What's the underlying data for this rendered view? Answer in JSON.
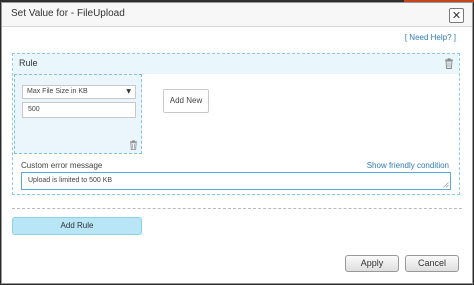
{
  "dialog": {
    "title": "Set Value for - FileUpload",
    "close_glyph": "✕",
    "help_link": "[ Need Help? ]"
  },
  "rule": {
    "title": "Rule",
    "condition": {
      "selected_option": "Max File Size in KB",
      "value": "500"
    },
    "add_new_label": "Add New",
    "custom_error": {
      "label": "Custom error message",
      "friendly_link": "Show friendly condition",
      "value": "Upload is limited to 500 KB"
    }
  },
  "actions": {
    "add_rule_label": "Add Rule",
    "apply_label": "Apply",
    "cancel_label": "Cancel"
  },
  "icons": {
    "rule_delete": "trash-icon",
    "condition_delete": "trash-icon",
    "dropdown": "caret-down-icon",
    "close": "close-icon",
    "resize": "resize-handle-icon"
  },
  "colors": {
    "accent_blue": "#2f7db8",
    "panel_header": "#e9f6fb",
    "add_rule_button": "#b8e6f7",
    "input_focus_border": "#5aa9dc"
  }
}
